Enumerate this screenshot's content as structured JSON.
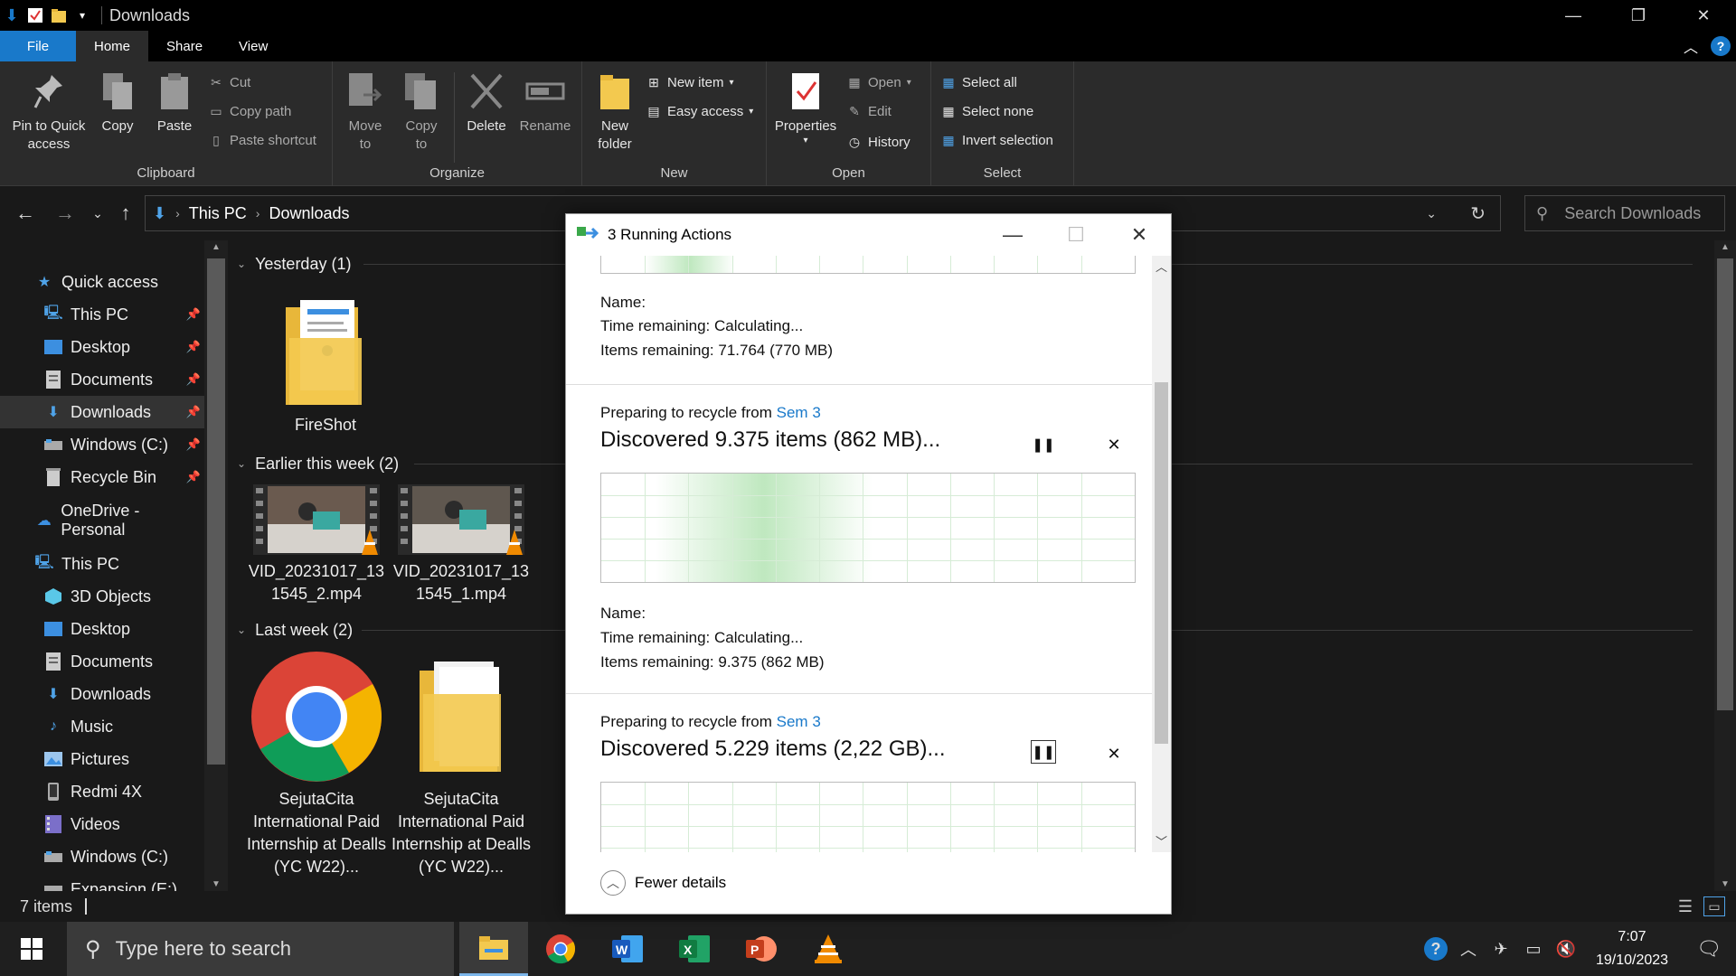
{
  "window": {
    "title": "Downloads",
    "controls": [
      "—",
      "❐",
      "✕"
    ]
  },
  "ribbon_tabs": [
    {
      "label": "File"
    },
    {
      "label": "Home"
    },
    {
      "label": "Share"
    },
    {
      "label": "View"
    }
  ],
  "ribbon": {
    "clipboard": {
      "label": "Clipboard",
      "pin": "Pin to Quick access",
      "copy": "Copy",
      "paste": "Paste",
      "cut": "Cut",
      "copy_path": "Copy path",
      "paste_shortcut": "Paste shortcut"
    },
    "organize": {
      "label": "Organize",
      "move_to": "Move to",
      "copy_to": "Copy to",
      "delete": "Delete",
      "rename": "Rename"
    },
    "new": {
      "label": "New",
      "new_folder": "New folder",
      "new_item": "New item",
      "easy_access": "Easy access"
    },
    "open": {
      "label": "Open",
      "properties": "Properties",
      "open": "Open",
      "edit": "Edit",
      "history": "History"
    },
    "select": {
      "label": "Select",
      "select_all": "Select all",
      "select_none": "Select none",
      "invert": "Invert selection"
    }
  },
  "address": {
    "crumbs": [
      "This PC",
      "Downloads"
    ],
    "search_placeholder": "Search Downloads"
  },
  "nav": {
    "items": [
      {
        "label": "Quick access",
        "icon": "star-icon"
      },
      {
        "label": "This PC",
        "icon": "pc-icon",
        "pinned": true
      },
      {
        "label": "Desktop",
        "icon": "desktop-icon",
        "pinned": true
      },
      {
        "label": "Documents",
        "icon": "documents-icon",
        "pinned": true
      },
      {
        "label": "Downloads",
        "icon": "download-icon",
        "pinned": true
      },
      {
        "label": "Windows (C:)",
        "icon": "drive-icon",
        "pinned": true
      },
      {
        "label": "Recycle Bin",
        "icon": "recycle-bin-icon",
        "pinned": true
      },
      {
        "label": "OneDrive - Personal",
        "icon": "cloud-icon"
      },
      {
        "label": "This PC",
        "icon": "pc-icon"
      },
      {
        "label": "3D Objects",
        "icon": "cube-icon"
      },
      {
        "label": "Desktop",
        "icon": "desktop-icon"
      },
      {
        "label": "Documents",
        "icon": "documents-icon"
      },
      {
        "label": "Downloads",
        "icon": "download-icon"
      },
      {
        "label": "Music",
        "icon": "music-icon"
      },
      {
        "label": "Pictures",
        "icon": "pictures-icon"
      },
      {
        "label": "Redmi 4X",
        "icon": "phone-icon"
      },
      {
        "label": "Videos",
        "icon": "videos-icon"
      },
      {
        "label": "Windows (C:)",
        "icon": "drive-icon"
      },
      {
        "label": "Expansion (E:)",
        "icon": "drive-icon"
      }
    ]
  },
  "content": {
    "groups": [
      {
        "header": "Yesterday (1)",
        "files": [
          {
            "name": "FireShot"
          }
        ]
      },
      {
        "header": "Earlier this week (2)",
        "files": [
          {
            "name": "VID_20231017_131545_2.mp4"
          },
          {
            "name": "VID_20231017_131545_1.mp4"
          }
        ]
      },
      {
        "header": "Last week (2)",
        "files": [
          {
            "name": "SejutaCita International Paid Internship at Dealls (YC W22)..."
          },
          {
            "name": "SejutaCita International Paid Internship at Dealls (YC W22)..."
          }
        ]
      }
    ]
  },
  "status": {
    "items": "7 items"
  },
  "dialog": {
    "title": "3 Running Actions",
    "op1": {
      "name_label": "Name:",
      "time": "Time remaining:  Calculating...",
      "items": "Items remaining:  71.764 (770 MB)"
    },
    "op2": {
      "prefix": "Preparing to recycle from ",
      "source": "Sem 3",
      "headline": "Discovered 9.375 items (862 MB)...",
      "name_label": "Name:",
      "time": "Time remaining:  Calculating...",
      "items": "Items remaining:  9.375 (862 MB)"
    },
    "op3": {
      "prefix": "Preparing to recycle from ",
      "source": "Sem 3",
      "headline": "Discovered 5.229 items (2,22 GB)..."
    },
    "footer": "Fewer details"
  },
  "taskbar": {
    "search_placeholder": "Type here to search",
    "time": "7:07",
    "date": "19/10/2023"
  },
  "colors": {
    "accent": "#1979ca",
    "background": "#191919",
    "ribbon": "#2b2b2b"
  }
}
